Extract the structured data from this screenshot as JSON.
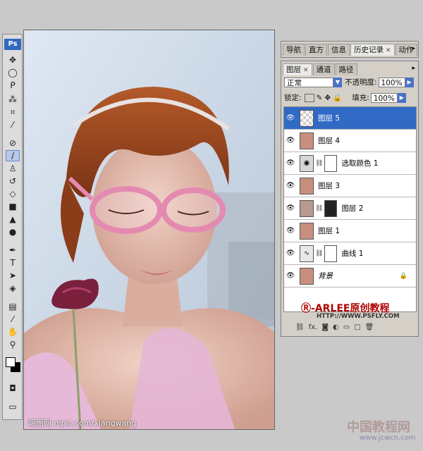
{
  "toolbox": {
    "logo": "Ps",
    "tools": [
      "move-icon",
      "lasso-marquee-icon",
      "lasso-icon",
      "magic-wand-icon",
      "crop-icon",
      "eyedropper-icon",
      "healing-icon",
      "brush-icon",
      "stamp-icon",
      "history-brush-icon",
      "eraser-icon",
      "gradient-icon",
      "blur-icon",
      "dodge-icon",
      "pen-icon",
      "text-icon",
      "path-select-icon",
      "shape-icon",
      "notes-icon",
      "eyedropper2-icon",
      "hand-icon",
      "zoom-icon"
    ],
    "type_glyph": "T"
  },
  "canvas": {
    "watermark": "昵图网 nipic.com/xiangwang"
  },
  "history_panel": {
    "tabs": [
      "导航",
      "直方",
      "信息",
      "历史记录",
      "动作"
    ],
    "active": "历史记录"
  },
  "layers_panel": {
    "tabs": [
      {
        "label": "图层",
        "active": true
      },
      {
        "label": "通道",
        "active": false
      },
      {
        "label": "路径",
        "active": false
      }
    ],
    "blend_mode": "正常",
    "opacity_label": "不透明度:",
    "opacity_value": "100%",
    "lock_label": "锁定:",
    "fill_label": "填充:",
    "fill_value": "100%",
    "layers": [
      {
        "name": "图层 5",
        "selected": true,
        "mask": false
      },
      {
        "name": "图层 4",
        "selected": false,
        "mask": false
      },
      {
        "name": "选取颜色 1",
        "selected": false,
        "mask": true
      },
      {
        "name": "图层 3",
        "selected": false,
        "mask": false
      },
      {
        "name": "图层 2",
        "selected": false,
        "mask": true
      },
      {
        "name": "图层 1",
        "selected": false,
        "mask": false
      },
      {
        "name": "曲线 1",
        "selected": false,
        "mask": true
      },
      {
        "name": "背景",
        "selected": false,
        "mask": false
      }
    ],
    "brand": "Ⓡ-ARLEE原创教程",
    "brand_url": "HTTP://WWW.PSFLY.COM",
    "footer_icons": [
      "link-icon",
      "fx-icon",
      "mask-icon",
      "adjust-icon",
      "group-icon",
      "new-layer-icon",
      "trash-icon"
    ]
  },
  "site_watermark": {
    "title": "中国教程网",
    "url": "www.jcwcn.com"
  }
}
